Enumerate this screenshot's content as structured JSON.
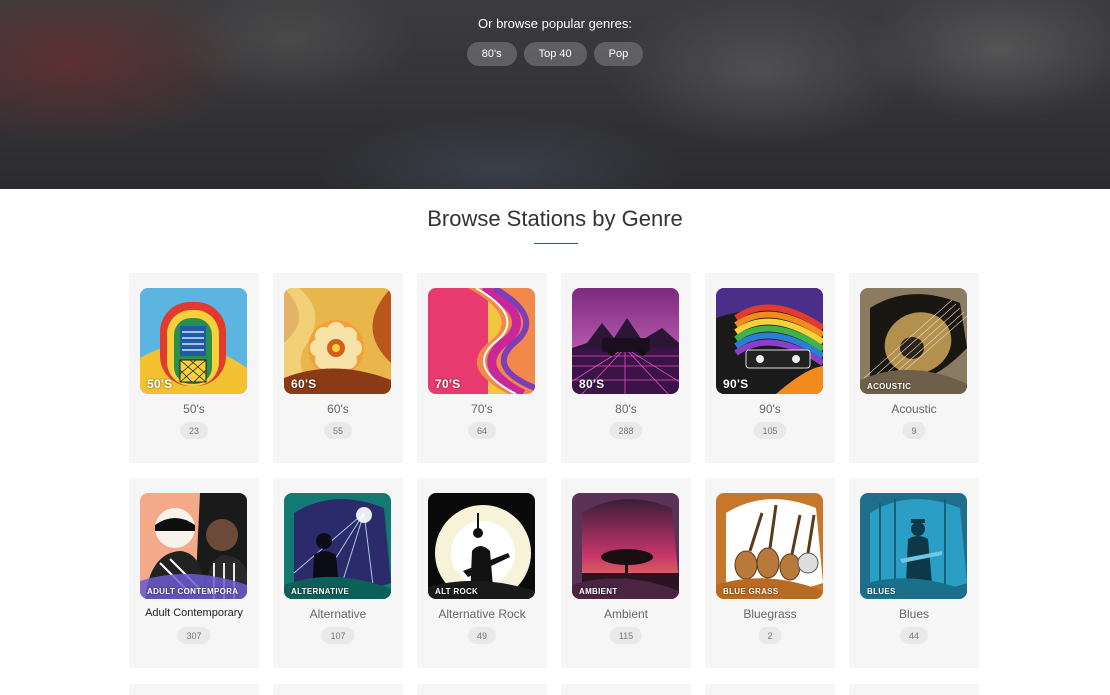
{
  "hero": {
    "title": "Or browse popular genres:",
    "pills": [
      "80's",
      "Top 40",
      "Pop"
    ]
  },
  "section": {
    "title": "Browse Stations by Genre",
    "accent_color": "#c8143c"
  },
  "genres": [
    {
      "name": "50's",
      "count": "23",
      "art_label": "50'S"
    },
    {
      "name": "60's",
      "count": "55",
      "art_label": "60'S"
    },
    {
      "name": "70's",
      "count": "64",
      "art_label": "70'S"
    },
    {
      "name": "80's",
      "count": "288",
      "art_label": "80'S"
    },
    {
      "name": "90's",
      "count": "105",
      "art_label": "90'S"
    },
    {
      "name": "Acoustic",
      "count": "9",
      "art_label": "ACOUSTIC"
    },
    {
      "name": "Adult Contemporary",
      "count": "307",
      "art_label": "ADULT CONTEMPORA"
    },
    {
      "name": "Alternative",
      "count": "107",
      "art_label": "ALTERNATIVE"
    },
    {
      "name": "Alternative Rock",
      "count": "49",
      "art_label": "ALT ROCK"
    },
    {
      "name": "Ambient",
      "count": "115",
      "art_label": "AMBIENT"
    },
    {
      "name": "Bluegrass",
      "count": "2",
      "art_label": "BLUE GRASS"
    },
    {
      "name": "Blues",
      "count": "44",
      "art_label": "BLUES"
    }
  ]
}
